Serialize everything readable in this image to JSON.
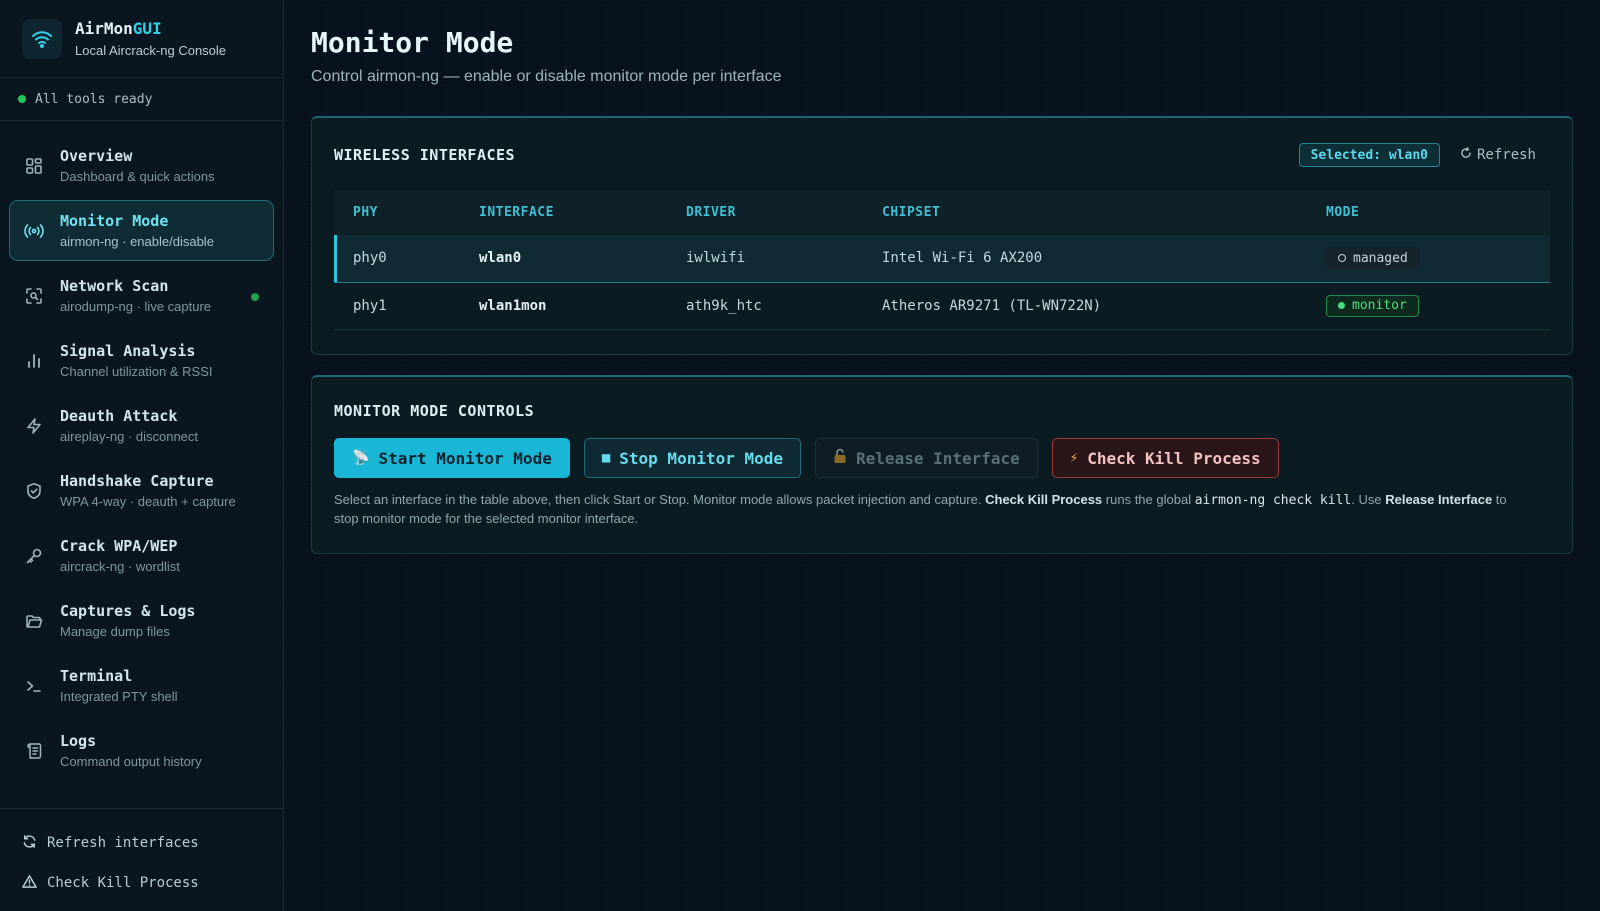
{
  "brand": {
    "name_part1": "AirMon",
    "name_part2": "GUI",
    "subtitle": "Local Aircrack-ng Console"
  },
  "status": {
    "text": "All tools ready",
    "color": "#22c55e"
  },
  "nav": [
    {
      "label": "Overview",
      "sub": "Dashboard & quick actions",
      "icon": "grid-icon"
    },
    {
      "label": "Monitor Mode",
      "sub": "airmon-ng · enable/disable",
      "icon": "broadcast-icon",
      "active": true
    },
    {
      "label": "Network Scan",
      "sub": "airodump-ng · live capture",
      "icon": "scan-icon",
      "indicator": true
    },
    {
      "label": "Signal Analysis",
      "sub": "Channel utilization & RSSI",
      "icon": "bar-chart-icon"
    },
    {
      "label": "Deauth Attack",
      "sub": "aireplay-ng · disconnect",
      "icon": "lightning-icon"
    },
    {
      "label": "Handshake Capture",
      "sub": "WPA 4-way · deauth + capture",
      "icon": "shield-icon"
    },
    {
      "label": "Crack WPA/WEP",
      "sub": "aircrack-ng · wordlist",
      "icon": "key-icon"
    },
    {
      "label": "Captures & Logs",
      "sub": "Manage dump files",
      "icon": "folder-icon"
    },
    {
      "label": "Terminal",
      "sub": "Integrated PTY shell",
      "icon": "terminal-icon"
    },
    {
      "label": "Logs",
      "sub": "Command output history",
      "icon": "scroll-icon"
    }
  ],
  "footer": {
    "refresh": "Refresh interfaces",
    "check_kill": "Check Kill Process"
  },
  "page": {
    "title": "Monitor Mode",
    "subtitle": "Control airmon-ng — enable or disable monitor mode per interface"
  },
  "interfaces_card": {
    "title": "WIRELESS INTERFACES",
    "selected": "Selected: wlan0",
    "refresh": "Refresh",
    "columns": [
      "PHY",
      "INTERFACE",
      "DRIVER",
      "CHIPSET",
      "MODE"
    ],
    "rows": [
      {
        "phy": "phy0",
        "interface": "wlan0",
        "driver": "iwlwifi",
        "chipset": "Intel Wi-Fi 6 AX200",
        "mode": "managed"
      },
      {
        "phy": "phy1",
        "interface": "wlan1mon",
        "driver": "ath9k_htc",
        "chipset": "Atheros AR9271 (TL-WN722N)",
        "mode": "monitor"
      }
    ]
  },
  "controls_card": {
    "title": "MONITOR MODE CONTROLS",
    "buttons": {
      "start": "Start Monitor Mode",
      "stop": "Stop Monitor Mode",
      "release": "Release Interface",
      "check_kill": "Check Kill Process"
    },
    "help": {
      "p1": "Select an interface in the table above, then click Start or Stop. Monitor mode allows packet injection and capture.",
      "b1": "Check Kill Process",
      "p2": "runs the global",
      "code": "airmon-ng check kill",
      "p3": ". Use",
      "b2": "Release Interface",
      "p4": "to stop monitor mode for the selected monitor interface."
    }
  },
  "colors": {
    "accent": "#2fd0e6",
    "success": "#22c55e",
    "danger": "#9b3a3a"
  }
}
